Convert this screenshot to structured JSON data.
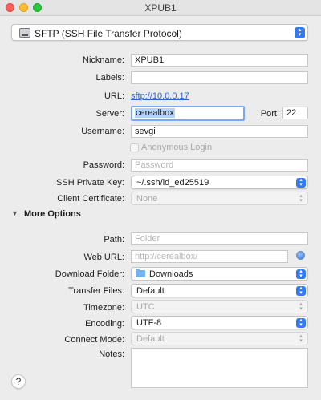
{
  "window": {
    "title": "XPUB1"
  },
  "protocol": {
    "value": "SFTP (SSH File Transfer Protocol)"
  },
  "form": {
    "nickname": {
      "label": "Nickname:",
      "value": "XPUB1"
    },
    "labels": {
      "label": "Labels:",
      "value": ""
    },
    "url": {
      "label": "URL:",
      "value": "sftp://10.0.0.17"
    },
    "server": {
      "label": "Server:",
      "value": "cerealbox"
    },
    "port": {
      "label": "Port:",
      "value": "22"
    },
    "username": {
      "label": "Username:",
      "value": "sevgi"
    },
    "anonymous": {
      "label": "Anonymous Login",
      "checked": false
    },
    "password": {
      "label": "Password:",
      "placeholder": "Password"
    },
    "ssh_key": {
      "label": "SSH Private Key:",
      "value": "~/.ssh/id_ed25519"
    },
    "client_cert": {
      "label": "Client Certificate:",
      "value": "None"
    }
  },
  "more_options": {
    "title": "More Options",
    "path": {
      "label": "Path:",
      "placeholder": "Folder"
    },
    "web_url": {
      "label": "Web URL:",
      "placeholder": "http://cerealbox/"
    },
    "download_folder": {
      "label": "Download Folder:",
      "value": "Downloads"
    },
    "transfer_files": {
      "label": "Transfer Files:",
      "value": "Default"
    },
    "timezone": {
      "label": "Timezone:",
      "value": "UTC"
    },
    "encoding": {
      "label": "Encoding:",
      "value": "UTF-8"
    },
    "connect_mode": {
      "label": "Connect Mode:",
      "value": "Default"
    },
    "notes": {
      "label": "Notes:",
      "value": ""
    }
  },
  "help": {
    "label": "?"
  },
  "colors": {
    "accent": "#3478f6",
    "link": "#2a64d6",
    "focus_ring": "#7aa7f7"
  }
}
